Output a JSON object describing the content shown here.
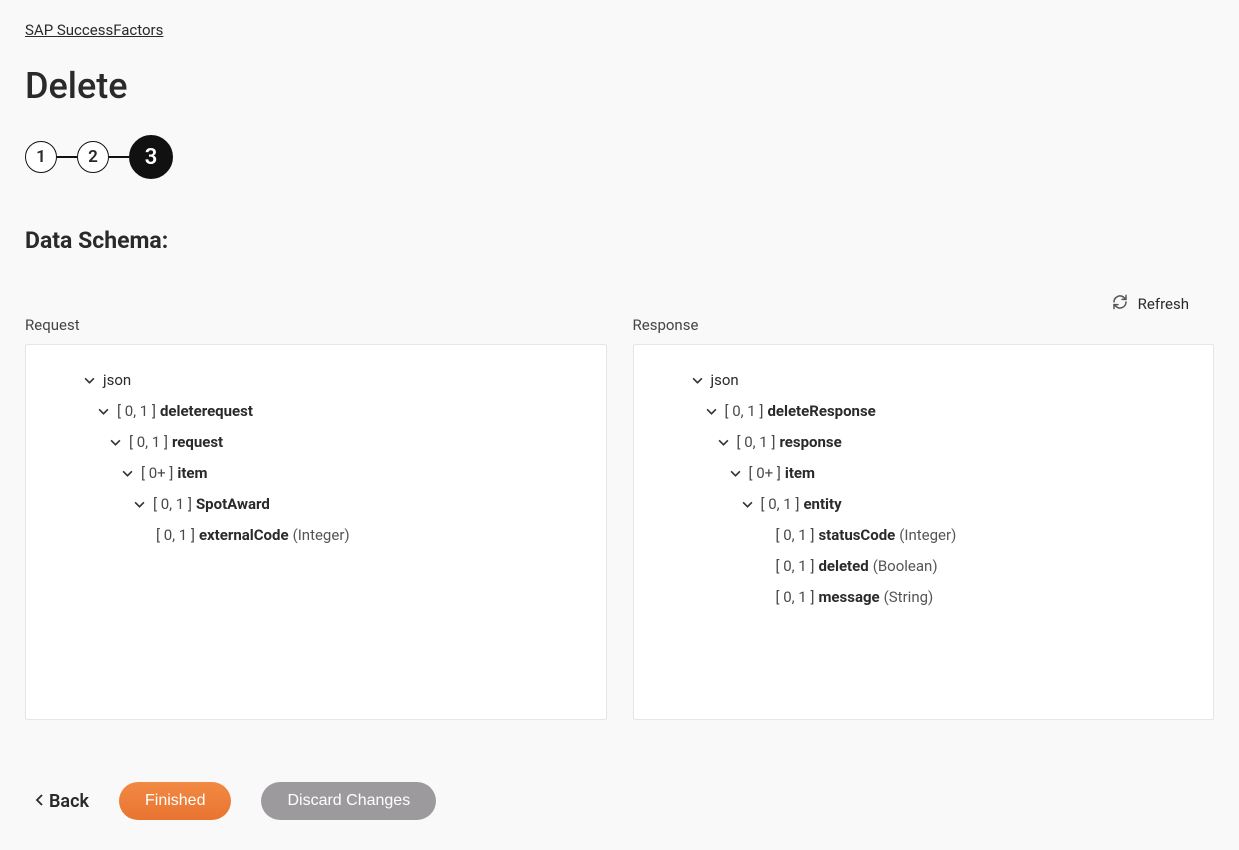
{
  "breadcrumb": {
    "label": "SAP SuccessFactors"
  },
  "page": {
    "title": "Delete",
    "section": "Data Schema:"
  },
  "stepper": {
    "steps": [
      "1",
      "2",
      "3"
    ],
    "activeIndex": 2
  },
  "actions": {
    "refresh": "Refresh",
    "back": "Back",
    "finished": "Finished",
    "discard": "Discard Changes"
  },
  "panels": {
    "request": {
      "label": "Request",
      "root": "json",
      "nodes": {
        "n1": {
          "card": "[ 0, 1 ]",
          "name": "deleterequest"
        },
        "n2": {
          "card": "[ 0, 1 ]",
          "name": "request"
        },
        "n3": {
          "card": "[ 0+ ]",
          "name": "item"
        },
        "n4": {
          "card": "[ 0, 1 ]",
          "name": "SpotAward"
        },
        "n5": {
          "card": "[ 0, 1 ]",
          "name": "externalCode",
          "type": "(Integer)"
        }
      }
    },
    "response": {
      "label": "Response",
      "root": "json",
      "nodes": {
        "n1": {
          "card": "[ 0, 1 ]",
          "name": "deleteResponse"
        },
        "n2": {
          "card": "[ 0, 1 ]",
          "name": "response"
        },
        "n3": {
          "card": "[ 0+ ]",
          "name": "item"
        },
        "n4": {
          "card": "[ 0, 1 ]",
          "name": "entity"
        },
        "n5": {
          "card": "[ 0, 1 ]",
          "name": "statusCode",
          "type": "(Integer)"
        },
        "n6": {
          "card": "[ 0, 1 ]",
          "name": "deleted",
          "type": "(Boolean)"
        },
        "n7": {
          "card": "[ 0, 1 ]",
          "name": "message",
          "type": "(String)"
        }
      }
    }
  }
}
